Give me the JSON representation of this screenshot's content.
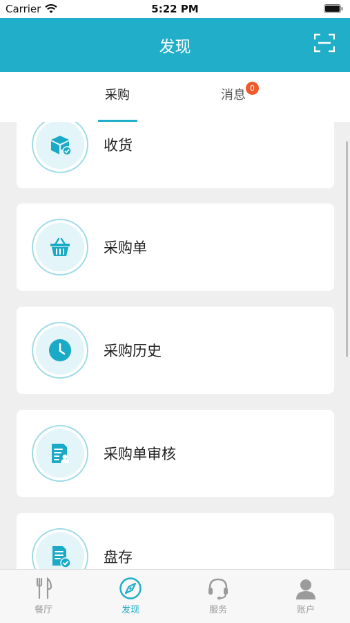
{
  "status_bar": {
    "carrier": "Carrier",
    "time": "5:22 PM"
  },
  "nav": {
    "title": "发现",
    "scan_icon": "scan-icon"
  },
  "tabs": [
    {
      "label": "采购",
      "active": true
    },
    {
      "label": "消息",
      "active": false,
      "badge": "0"
    }
  ],
  "menu": [
    {
      "label": "收货",
      "icon": "package-icon"
    },
    {
      "label": "采购单",
      "icon": "basket-icon"
    },
    {
      "label": "采购历史",
      "icon": "clock-icon"
    },
    {
      "label": "采购单审核",
      "icon": "document-user-icon"
    },
    {
      "label": "盘存",
      "icon": "checklist-icon"
    }
  ],
  "bottom_nav": [
    {
      "label": "餐厅",
      "icon": "restaurant-icon",
      "active": false
    },
    {
      "label": "发现",
      "icon": "compass-icon",
      "active": true
    },
    {
      "label": "服务",
      "icon": "headset-icon",
      "active": false
    },
    {
      "label": "账户",
      "icon": "user-icon",
      "active": false
    }
  ],
  "colors": {
    "accent": "#20aec9",
    "badge": "#f05a2a",
    "icon_bg": "#e3f5f9",
    "ring": "#9fdbe7"
  }
}
